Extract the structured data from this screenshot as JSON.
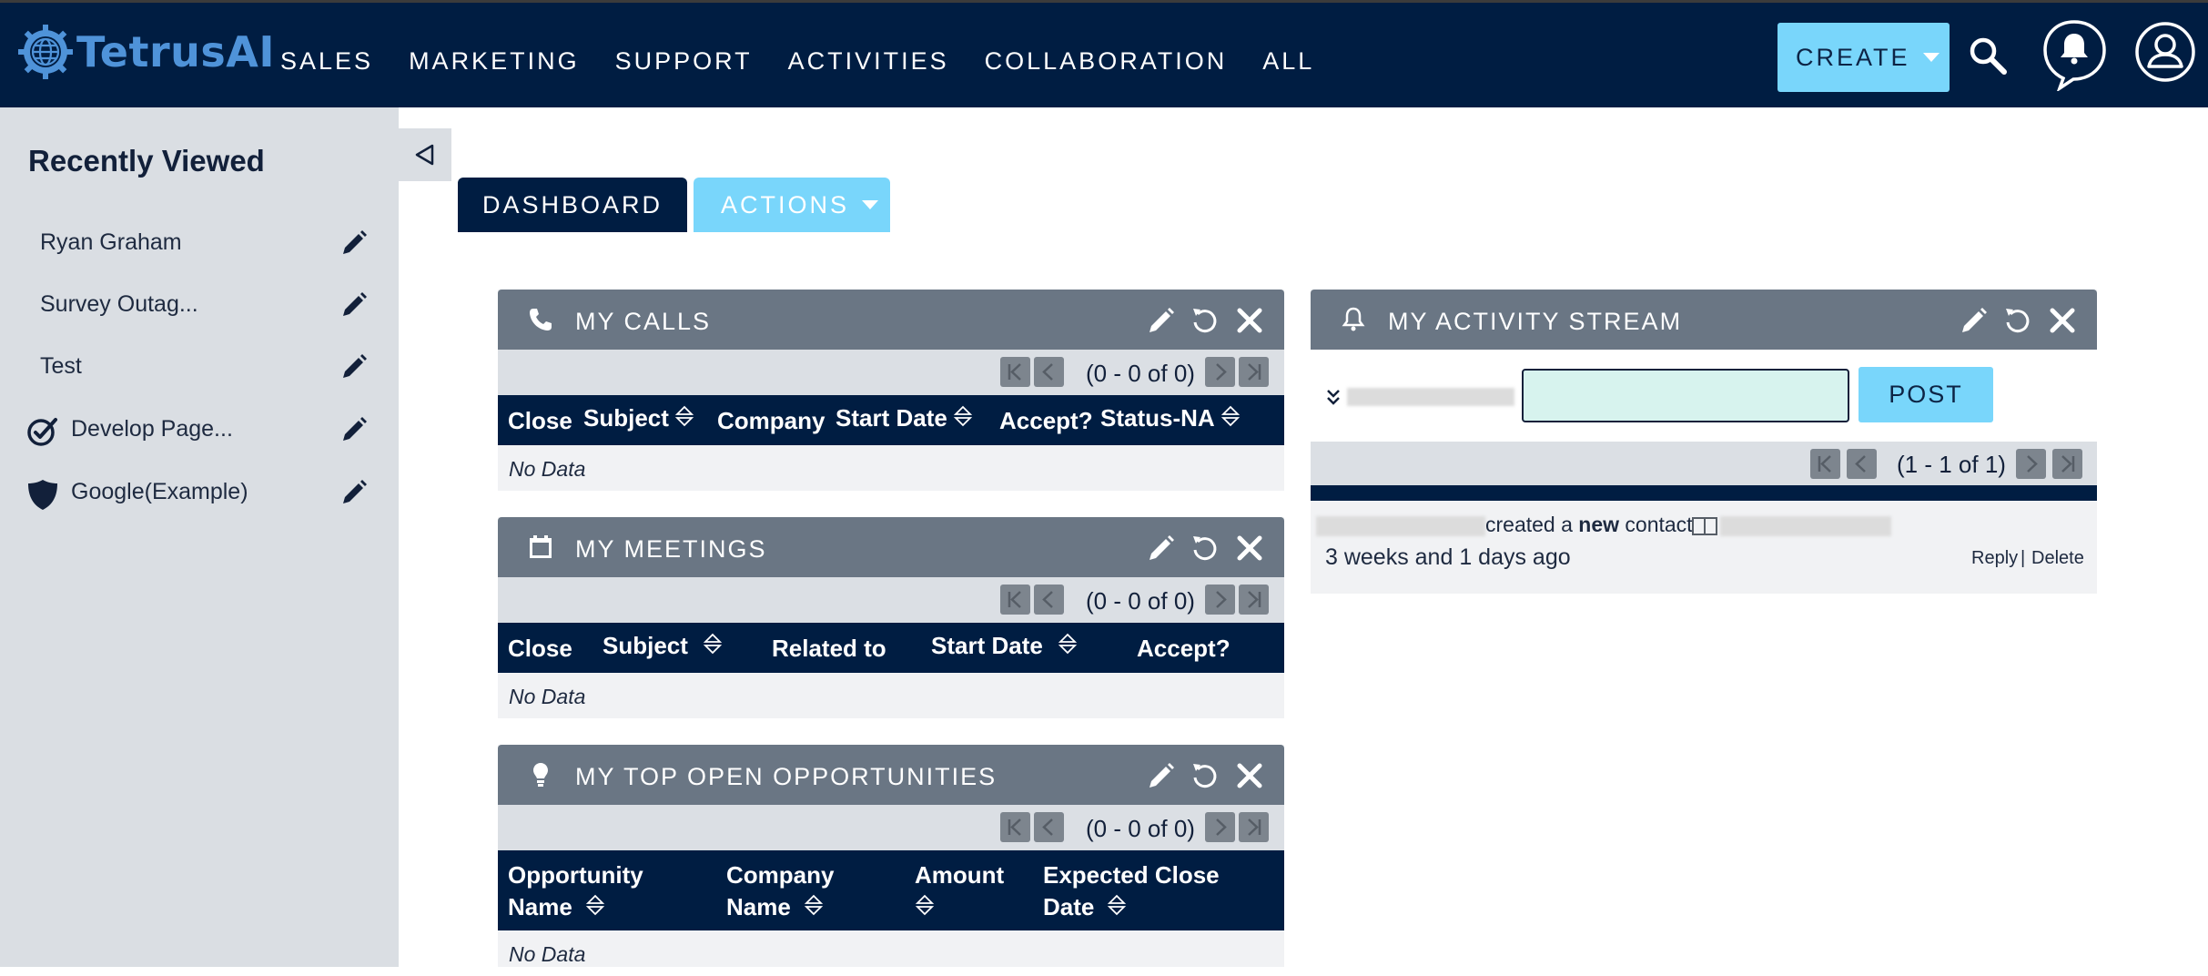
{
  "brand": {
    "name": "TetrusAI",
    "color": "#4f93d9"
  },
  "nav": {
    "items": [
      {
        "label": "SALES"
      },
      {
        "label": "MARKETING"
      },
      {
        "label": "SUPPORT"
      },
      {
        "label": "ACTIVITIES"
      },
      {
        "label": "COLLABORATION"
      },
      {
        "label": "ALL"
      }
    ],
    "create_label": "CREATE",
    "icons": [
      "search-icon",
      "notification-bell-icon",
      "user-profile-icon"
    ]
  },
  "sidebar": {
    "title": "Recently Viewed",
    "items": [
      {
        "label": "Ryan Graham",
        "icon": ""
      },
      {
        "label": "Survey Outag...",
        "icon": ""
      },
      {
        "label": "Test",
        "icon": ""
      },
      {
        "label": "Develop Page...",
        "icon": "target-check-icon"
      },
      {
        "label": "Google(Example)",
        "icon": "shield-icon"
      }
    ]
  },
  "tabs": {
    "dashboard": "DASHBOARD",
    "actions": "ACTIONS"
  },
  "dashlets": {
    "calls": {
      "title": "MY CALLS",
      "pagination": "(0 - 0 of 0)",
      "columns": [
        "Close",
        "Subject",
        "Company",
        "Start Date",
        "Accept?",
        "Status-NA"
      ],
      "empty": "No Data"
    },
    "meetings": {
      "title": "MY MEETINGS",
      "pagination": "(0 - 0 of 0)",
      "columns": [
        "Close",
        "Subject",
        "Related to",
        "Start Date",
        "Accept?"
      ],
      "empty": "No Data"
    },
    "opportunities": {
      "title": "MY TOP OPEN OPPORTUNITIES",
      "pagination": "(0 - 0 of 0)",
      "columns": [
        {
          "l1": "Opportunity",
          "l2": "Name"
        },
        {
          "l1": "Company",
          "l2": "Name"
        },
        {
          "l1": "Amount",
          "l2": ""
        },
        {
          "l1": "Expected Close",
          "l2": "Date"
        }
      ],
      "empty": "No Data"
    },
    "activity": {
      "title": "MY ACTIVITY STREAM",
      "post_label": "POST",
      "input_value": "",
      "pagination": "(1 - 1 of 1)",
      "entry": {
        "text_a": "created a",
        "text_b": "new",
        "text_c": "contact",
        "time": "3 weeks and 1 days ago",
        "reply": "Reply",
        "sep": "|",
        "delete": "Delete"
      }
    }
  },
  "colors": {
    "navy": "#001d42",
    "accent": "#79d6fb",
    "dashlet_header": "#6a7684",
    "sidebar": "#dadee3"
  }
}
